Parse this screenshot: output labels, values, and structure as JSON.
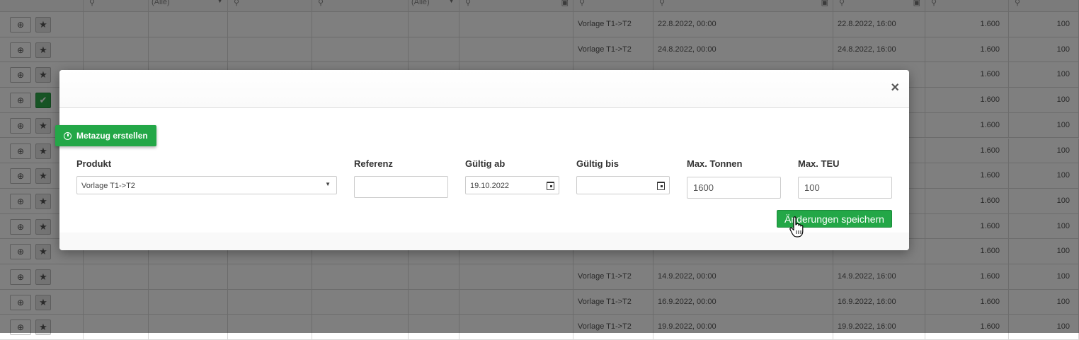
{
  "grid": {
    "filters": {
      "alle_1": "(Alle)",
      "alle_2": "(Alle)"
    },
    "rows": [
      {
        "produkt": "Vorlage T1->T2",
        "von": "22.8.2022, 00:00",
        "bis": "22.8.2022, 16:00",
        "tonnen": "1.600",
        "teu": "100",
        "checked": false
      },
      {
        "produkt": "Vorlage T1->T2",
        "von": "24.8.2022, 00:00",
        "bis": "24.8.2022, 16:00",
        "tonnen": "1.600",
        "teu": "100",
        "checked": false
      },
      {
        "produkt": "",
        "von": "",
        "bis": "",
        "tonnen": "1.600",
        "teu": "100",
        "checked": false
      },
      {
        "produkt": "",
        "von": "",
        "bis": "",
        "tonnen": "1.600",
        "teu": "100",
        "checked": true
      },
      {
        "produkt": "",
        "von": "",
        "bis": "",
        "tonnen": "1.600",
        "teu": "100",
        "checked": false
      },
      {
        "produkt": "",
        "von": "",
        "bis": "",
        "tonnen": "1.600",
        "teu": "100",
        "checked": false
      },
      {
        "produkt": "",
        "von": "",
        "bis": "",
        "tonnen": "1.600",
        "teu": "100",
        "checked": false
      },
      {
        "produkt": "",
        "von": "",
        "bis": "",
        "tonnen": "1.600",
        "teu": "100",
        "checked": false
      },
      {
        "produkt": "",
        "von": "",
        "bis": "",
        "tonnen": "1.600",
        "teu": "100",
        "checked": false
      },
      {
        "produkt": "",
        "von": "",
        "bis": "",
        "tonnen": "1.600",
        "teu": "100",
        "checked": false
      },
      {
        "produkt": "Vorlage T1->T2",
        "von": "14.9.2022, 00:00",
        "bis": "14.9.2022, 16:00",
        "tonnen": "1.600",
        "teu": "100",
        "checked": false
      },
      {
        "produkt": "Vorlage T1->T2",
        "von": "16.9.2022, 00:00",
        "bis": "16.9.2022, 16:00",
        "tonnen": "1.600",
        "teu": "100",
        "checked": false
      },
      {
        "produkt": "Vorlage T1->T2",
        "von": "19.9.2022, 00:00",
        "bis": "19.9.2022, 16:00",
        "tonnen": "1.600",
        "teu": "100",
        "checked": false
      }
    ]
  },
  "modal": {
    "close_label": "×",
    "meta_button_label": "Metazug erstellen",
    "labels": {
      "produkt": "Produkt",
      "referenz": "Referenz",
      "gueltig_ab": "Gültig ab",
      "gueltig_bis": "Gültig bis",
      "max_tonnen": "Max. Tonnen",
      "max_teu": "Max. TEU"
    },
    "values": {
      "produkt": "Vorlage T1->T2",
      "referenz": "",
      "gueltig_ab": "19.10.2022",
      "gueltig_bis": "",
      "max_tonnen": "1600",
      "max_teu": "100"
    },
    "save_label": "Änderungen speichern"
  },
  "colors": {
    "accent_green": "#23a747"
  }
}
